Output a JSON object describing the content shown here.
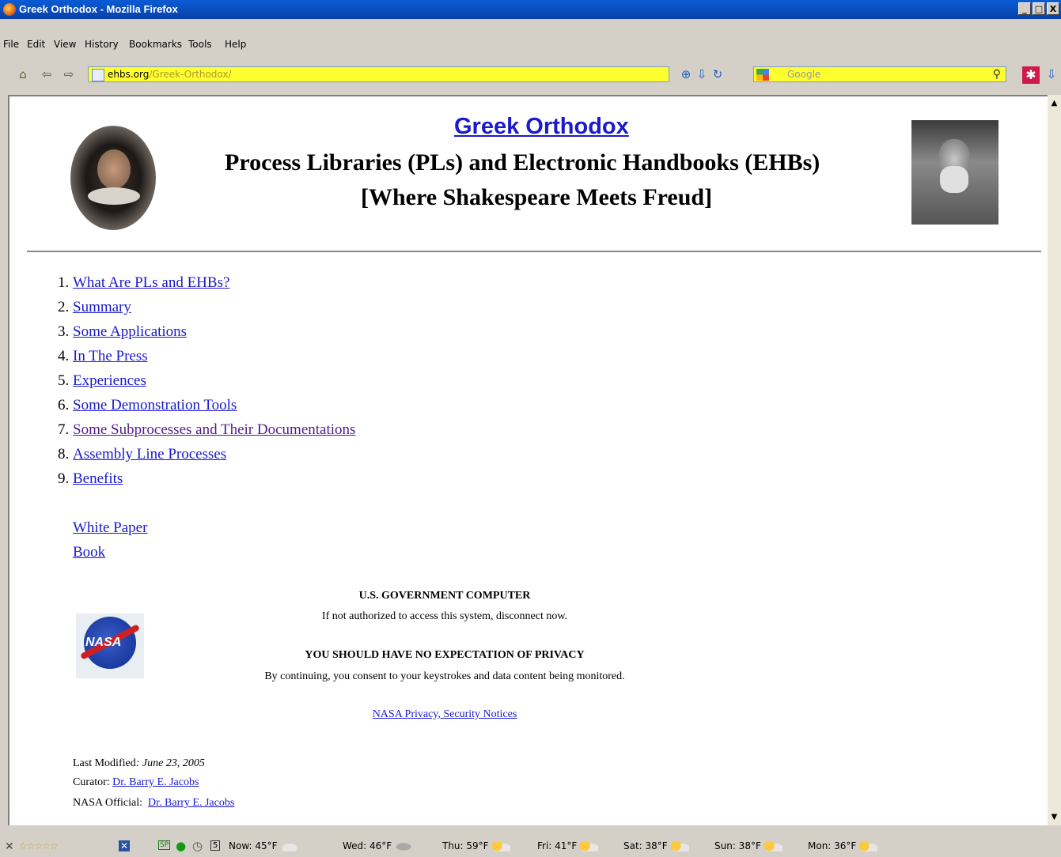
{
  "window": {
    "title": "Greek Orthodox - Mozilla Firefox",
    "buttons": {
      "minimize": "_",
      "maximize": "□",
      "close": "X"
    }
  },
  "menu": [
    "File",
    "Edit",
    "View",
    "History",
    "Bookmarks",
    "Tools",
    "Help"
  ],
  "navigation": {
    "url_domain": "ehbs.org",
    "url_path": "/Greek-Orthodox/",
    "search_placeholder": "Google"
  },
  "page": {
    "title_link": "Greek Orthodox",
    "subtitle_line1": "Process Libraries (PLs) and Electronic Handbooks (EHBs)",
    "subtitle_line2": "[Where Shakespeare Meets Freud]",
    "toc": [
      {
        "num": "1.",
        "label": "What Are PLs and EHBs?"
      },
      {
        "num": "2.",
        "label": "Summary"
      },
      {
        "num": "3.",
        "label": "Some Applications"
      },
      {
        "num": "4.",
        "label": "In The Press"
      },
      {
        "num": "5.",
        "label": "Experiences"
      },
      {
        "num": "6.",
        "label": "Some Demonstration Tools"
      },
      {
        "num": "7.",
        "label": "Some Subprocesses and Their Documentations"
      },
      {
        "num": "8.",
        "label": "Assembly Line Processes"
      },
      {
        "num": "9.",
        "label": "Benefits"
      }
    ],
    "extra_links": {
      "white_paper": "White Paper",
      "book": "Book"
    },
    "notice": {
      "heading1": "U.S. GOVERNMENT COMPUTER",
      "line1": "If not authorized to access this system, disconnect now.",
      "heading2": "YOU SHOULD HAVE NO EXPECTATION OF PRIVACY",
      "line2": "By continuing, you consent to your keystrokes and data content being monitored.",
      "privacy_link": "NASA Privacy, Security Notices"
    },
    "nasa_logo_text": "NASA",
    "footer": {
      "last_modified_label": "Last Modified",
      "last_modified_value": "June 23, 2005",
      "curator_label": "Curator:",
      "curator_name": "Dr. Barry E. Jacobs",
      "official_label": "NASA Official:",
      "official_name": "Dr. Barry E. Jacobs"
    }
  },
  "statusbar": {
    "sp": "SP",
    "calendar_day": "5",
    "weather": [
      {
        "label": "Now: 45°F",
        "icon": "cloud"
      },
      {
        "label": "Wed: 46°F",
        "icon": "rain"
      },
      {
        "label": "Thu: 59°F",
        "icon": "sun"
      },
      {
        "label": "Fri: 41°F",
        "icon": "sun"
      },
      {
        "label": "Sat: 38°F",
        "icon": "sun"
      },
      {
        "label": "Sun: 38°F",
        "icon": "sun"
      },
      {
        "label": "Mon: 36°F",
        "icon": "sun"
      }
    ]
  }
}
